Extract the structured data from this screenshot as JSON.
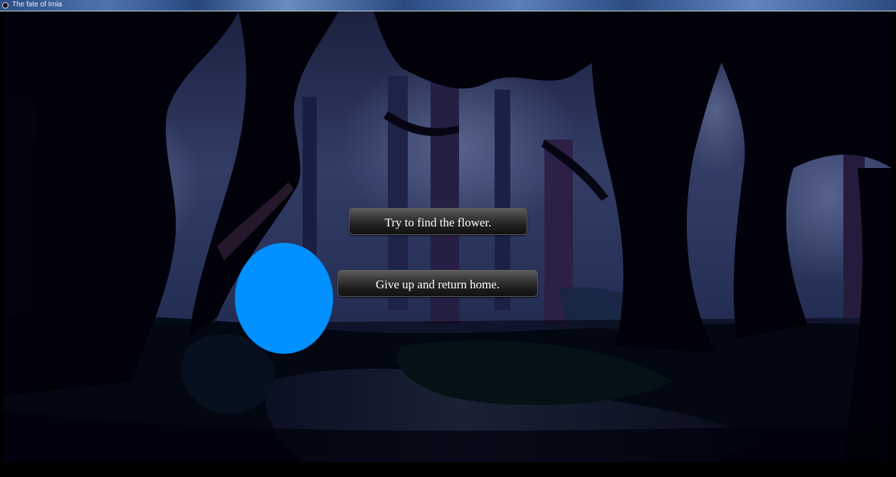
{
  "window": {
    "title": "The fate of Irnia",
    "icon": "app-icon"
  },
  "scene": {
    "name": "dark-forest-background",
    "colors": {
      "sky": "#6f7fb8",
      "trunks": "#030308",
      "path": "#5f7aa8",
      "grass": "#0f3a2c"
    }
  },
  "choices": [
    {
      "label": "Try to find the flower."
    },
    {
      "label": "Give up and return home."
    }
  ],
  "player": {
    "shape": "circle",
    "color": "#0090ff"
  }
}
